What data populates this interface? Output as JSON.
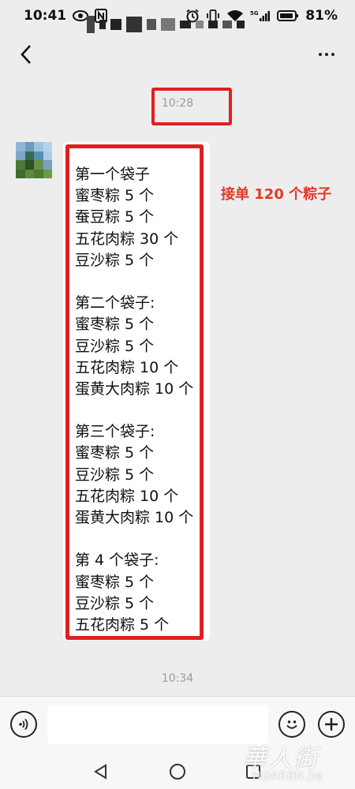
{
  "status_bar": {
    "time": "10:41",
    "battery": "81%",
    "network": "5G",
    "icons": [
      "eye-icon",
      "nfc-icon",
      "alarm-icon",
      "vibrate-icon",
      "wifi-icon",
      "signal-icon",
      "battery-icon"
    ]
  },
  "header": {
    "back_icon": "chevron-left-icon",
    "title": "",
    "more_icon": "more-dots-icon"
  },
  "chat": {
    "timestamp_top": "10:28",
    "timestamp_bottom": "10:34",
    "message_lines": [
      "第一个袋子",
      "蜜枣粽 5 个",
      "蚕豆粽 5 个",
      "五花肉粽 30 个",
      "豆沙粽 5 个",
      "",
      "第二个袋子:",
      "蜜枣粽 5 个",
      "豆沙粽 5 个",
      "五花肉粽 10 个",
      "蛋黄大肉粽 10 个",
      "",
      "第三个袋子:",
      "蜜枣粽 5 个",
      "豆沙粽 5 个",
      "五花肉粽 10 个",
      "蛋黄大肉粽 10 个",
      "",
      "第 4 个袋子:",
      "蜜枣粽 5 个",
      "豆沙粽 5 个",
      "五花肉粽 5 个"
    ],
    "annotation": "接单 120 个粽子"
  },
  "input_bar": {
    "voice_icon": "voice-icon",
    "input_value": "",
    "emoji_icon": "emoji-icon",
    "plus_icon": "plus-icon"
  },
  "nav_bar": {
    "icons": [
      "nav-back-icon",
      "nav-home-icon",
      "nav-recent-icon"
    ]
  },
  "watermark": {
    "cn": "華人街",
    "en": "HUAREN.jie"
  },
  "colors": {
    "background": "#ededed",
    "bubble": "#ffffff",
    "highlight_red": "#e02020",
    "annotation_red": "#e03a2a"
  }
}
